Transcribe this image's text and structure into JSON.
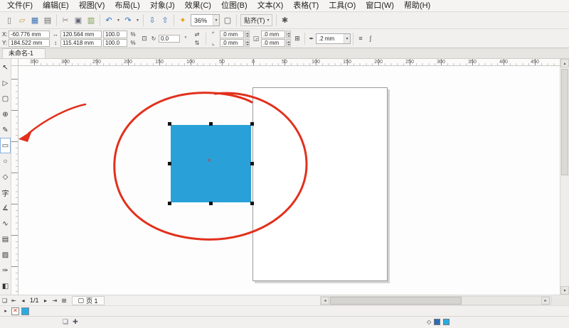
{
  "menu": {
    "items": [
      "文件(F)",
      "编辑(E)",
      "视图(V)",
      "布局(L)",
      "对象(J)",
      "效果(C)",
      "位图(B)",
      "文本(X)",
      "表格(T)",
      "工具(O)",
      "窗口(W)",
      "帮助(H)"
    ]
  },
  "standard_toolbar": {
    "new_glyph": "▯",
    "open_glyph": "▱",
    "save_glyph": "▦",
    "print_glyph": "▤",
    "cut_glyph": "✂",
    "copy_glyph": "▣",
    "paste_glyph": "▥",
    "undo_glyph": "↶",
    "redo_glyph": "↷",
    "dropdown_glyph": "▾",
    "import_glyph": "⇩",
    "export_glyph": "⇧",
    "launcher_glyph": "✦",
    "zoom_value": "36%",
    "preview_glyph": "▢",
    "snap_label": "贴齐(T)",
    "options_glyph": "✱"
  },
  "property_bar": {
    "x_label": "X:",
    "x_value": "-60.776 mm",
    "y_label": "Y:",
    "y_value": "184.522 mm",
    "width_glyph": "↔",
    "width_value": "120.564 mm",
    "height_glyph": "↕",
    "height_value": "115.418 mm",
    "scale_x": "100.0",
    "scale_y": "100.0",
    "percent": "%",
    "lock_glyph": "⊡",
    "angle_glyph": "↻",
    "angle_value": "0.0",
    "angle_unit": "°",
    "mirror_h_glyph": "⇄",
    "mirror_v_glyph": "⇅",
    "corner_round_glyph": "⌜",
    "corner_scallop_glyph": "⌞",
    "corner_chamfer_glyph": "◲",
    "corner_tl": ".0 mm",
    "corner_tr": ".0 mm",
    "corner_bl": ".0 mm",
    "corner_br": ".0 mm",
    "relative_corner_glyph": "⊞",
    "wrap_glyph": "≡",
    "outline_glyph": "✒",
    "outline_width": ".2 mm",
    "curve_glyph": "∫"
  },
  "document_tab": {
    "title": "未命名-1"
  },
  "ruler": {
    "h_ticks": [
      "350",
      "300",
      "250",
      "200",
      "150",
      "100",
      "50",
      "0",
      "50",
      "100",
      "150",
      "200",
      "250",
      "300",
      "350",
      "400",
      "450"
    ]
  },
  "toolbox": {
    "tools": [
      {
        "name": "pick-tool",
        "glyph": "↖"
      },
      {
        "name": "shape-tool",
        "glyph": "▷"
      },
      {
        "name": "crop-tool",
        "glyph": "▢"
      },
      {
        "name": "zoom-tool",
        "glyph": "⊕"
      },
      {
        "name": "freehand-tool",
        "glyph": "✎"
      },
      {
        "name": "rectangle-tool",
        "glyph": "▭"
      },
      {
        "name": "ellipse-tool",
        "glyph": "○"
      },
      {
        "name": "polygon-tool",
        "glyph": "◇"
      },
      {
        "name": "text-tool",
        "glyph": "字"
      },
      {
        "name": "dimension-tool",
        "glyph": "∡"
      },
      {
        "name": "connector-tool",
        "glyph": "∿"
      },
      {
        "name": "shadow-tool",
        "glyph": "▤"
      },
      {
        "name": "transparency-tool",
        "glyph": "▨"
      },
      {
        "name": "eyedropper-tool",
        "glyph": "✑"
      },
      {
        "name": "fill-tool",
        "glyph": "◧"
      }
    ]
  },
  "scene": {
    "object_fill": "#29a1d8",
    "center_glyph": "×"
  },
  "annotations": {
    "color": "#e2301c"
  },
  "navigation": {
    "sorter_glyph": "❏",
    "first_glyph": "⇤",
    "prev_glyph": "◂",
    "page_indicator": "1/1",
    "next_glyph": "▸",
    "last_glyph": "⇥",
    "add_page_glyph": "⊞",
    "page_icon_glyph": "▢",
    "page_tab_label": "页 1",
    "hscroll_left_glyph": "◂",
    "hscroll_right_glyph": "▸",
    "vscroll_up_glyph": "▴",
    "vscroll_down_glyph": "▾"
  },
  "palette": {
    "flyout_glyph": "▸",
    "no_color_glyph": "✕",
    "cyan_color": "#29abe2"
  },
  "status_bar": {
    "doc_icon_glyph": "❏",
    "add_icon_glyph": "✚",
    "diamond_glyph": "◇",
    "fill_color": "#2d6cb5",
    "outline_color": "#29abe2"
  }
}
